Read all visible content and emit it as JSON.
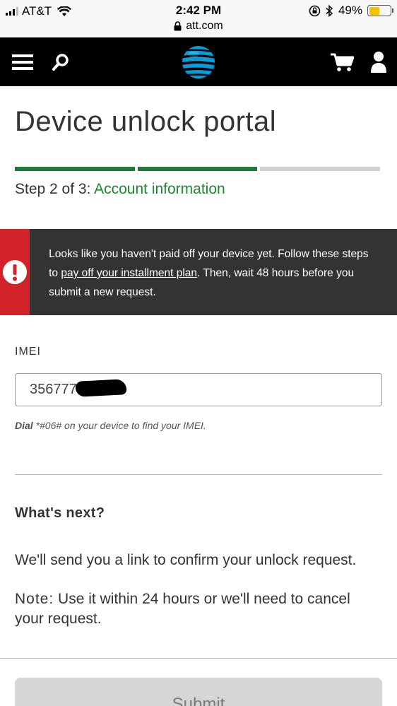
{
  "status_bar": {
    "carrier": "AT&T",
    "time": "2:42 PM",
    "url": "att.com",
    "battery": "49%",
    "battery_level": 0.49
  },
  "header": {
    "icons": [
      "menu-icon",
      "search-icon",
      "att-globe-logo",
      "cart-icon",
      "user-icon"
    ]
  },
  "page": {
    "title": "Device unlock portal",
    "progress": {
      "completed_steps": 2,
      "total_steps": 3
    },
    "step_prefix": "Step 2 of 3:",
    "step_name": "Account information"
  },
  "alert": {
    "text_before": "Looks like you haven't paid off your device yet. Follow these steps to ",
    "link": "pay off your installment plan",
    "text_after": ". Then, wait 48 hours before you submit a new request."
  },
  "imei": {
    "label": "IMEI",
    "value": "356777 7458",
    "hint_strong": "Dial",
    "hint_rest": " *#06# on your device to find your IMEI."
  },
  "whats_next": {
    "title": "What's next?",
    "body": "We'll send you a link to confirm your unlock request.",
    "note_label": "Note:",
    "note_text": " Use it within 24 hours or we'll need to cancel your request."
  },
  "submit_label": "Submit",
  "colors": {
    "green": "#1a8a2e",
    "progress_done": "#1f7a3a",
    "progress_todo": "#d0d0d0",
    "alert_red": "#d2232a",
    "alert_dark": "#333333",
    "att_blue": "#0568ae"
  }
}
